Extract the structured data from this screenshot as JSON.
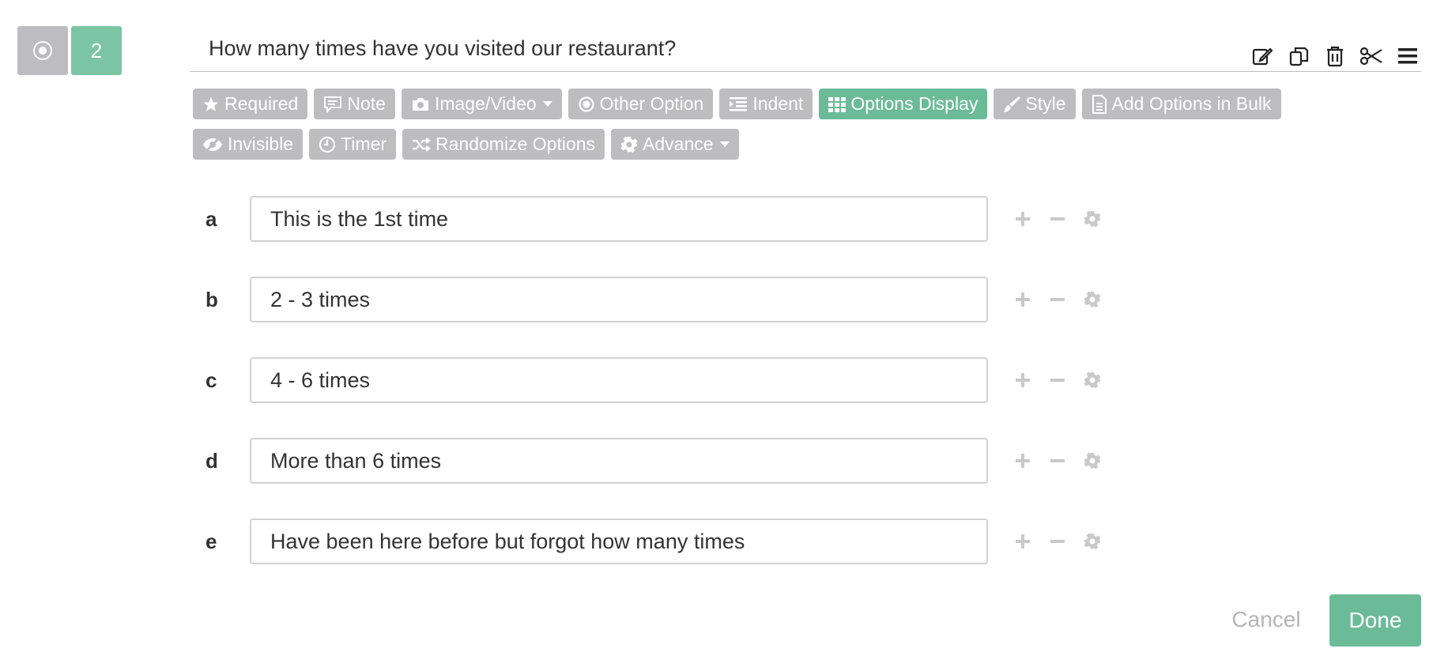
{
  "question": {
    "type_icon": "radio-icon",
    "number": "2",
    "text": "How many times have you visited our restaurant?"
  },
  "top_icons": [
    "edit-icon",
    "copy-icon",
    "trash-icon",
    "scissors-icon",
    "menu-icon"
  ],
  "toolbar": {
    "required": "Required",
    "note": "Note",
    "image_video": "Image/Video",
    "other_option": "Other Option",
    "indent": "Indent",
    "options_display": "Options Display",
    "style": "Style",
    "add_bulk": "Add Options in Bulk",
    "invisible": "Invisible",
    "timer": "Timer",
    "randomize": "Randomize Options",
    "advance": "Advance"
  },
  "options": [
    {
      "letter": "a",
      "value": "This is the 1st time"
    },
    {
      "letter": "b",
      "value": "2 - 3 times"
    },
    {
      "letter": "c",
      "value": "4 - 6 times"
    },
    {
      "letter": "d",
      "value": "More than 6 times"
    },
    {
      "letter": "e",
      "value": "Have been here before but forgot how many times"
    }
  ],
  "actions": {
    "cancel": "Cancel",
    "done": "Done"
  },
  "colors": {
    "accent": "#6cbb98",
    "button_gray": "#bdbdbf"
  }
}
